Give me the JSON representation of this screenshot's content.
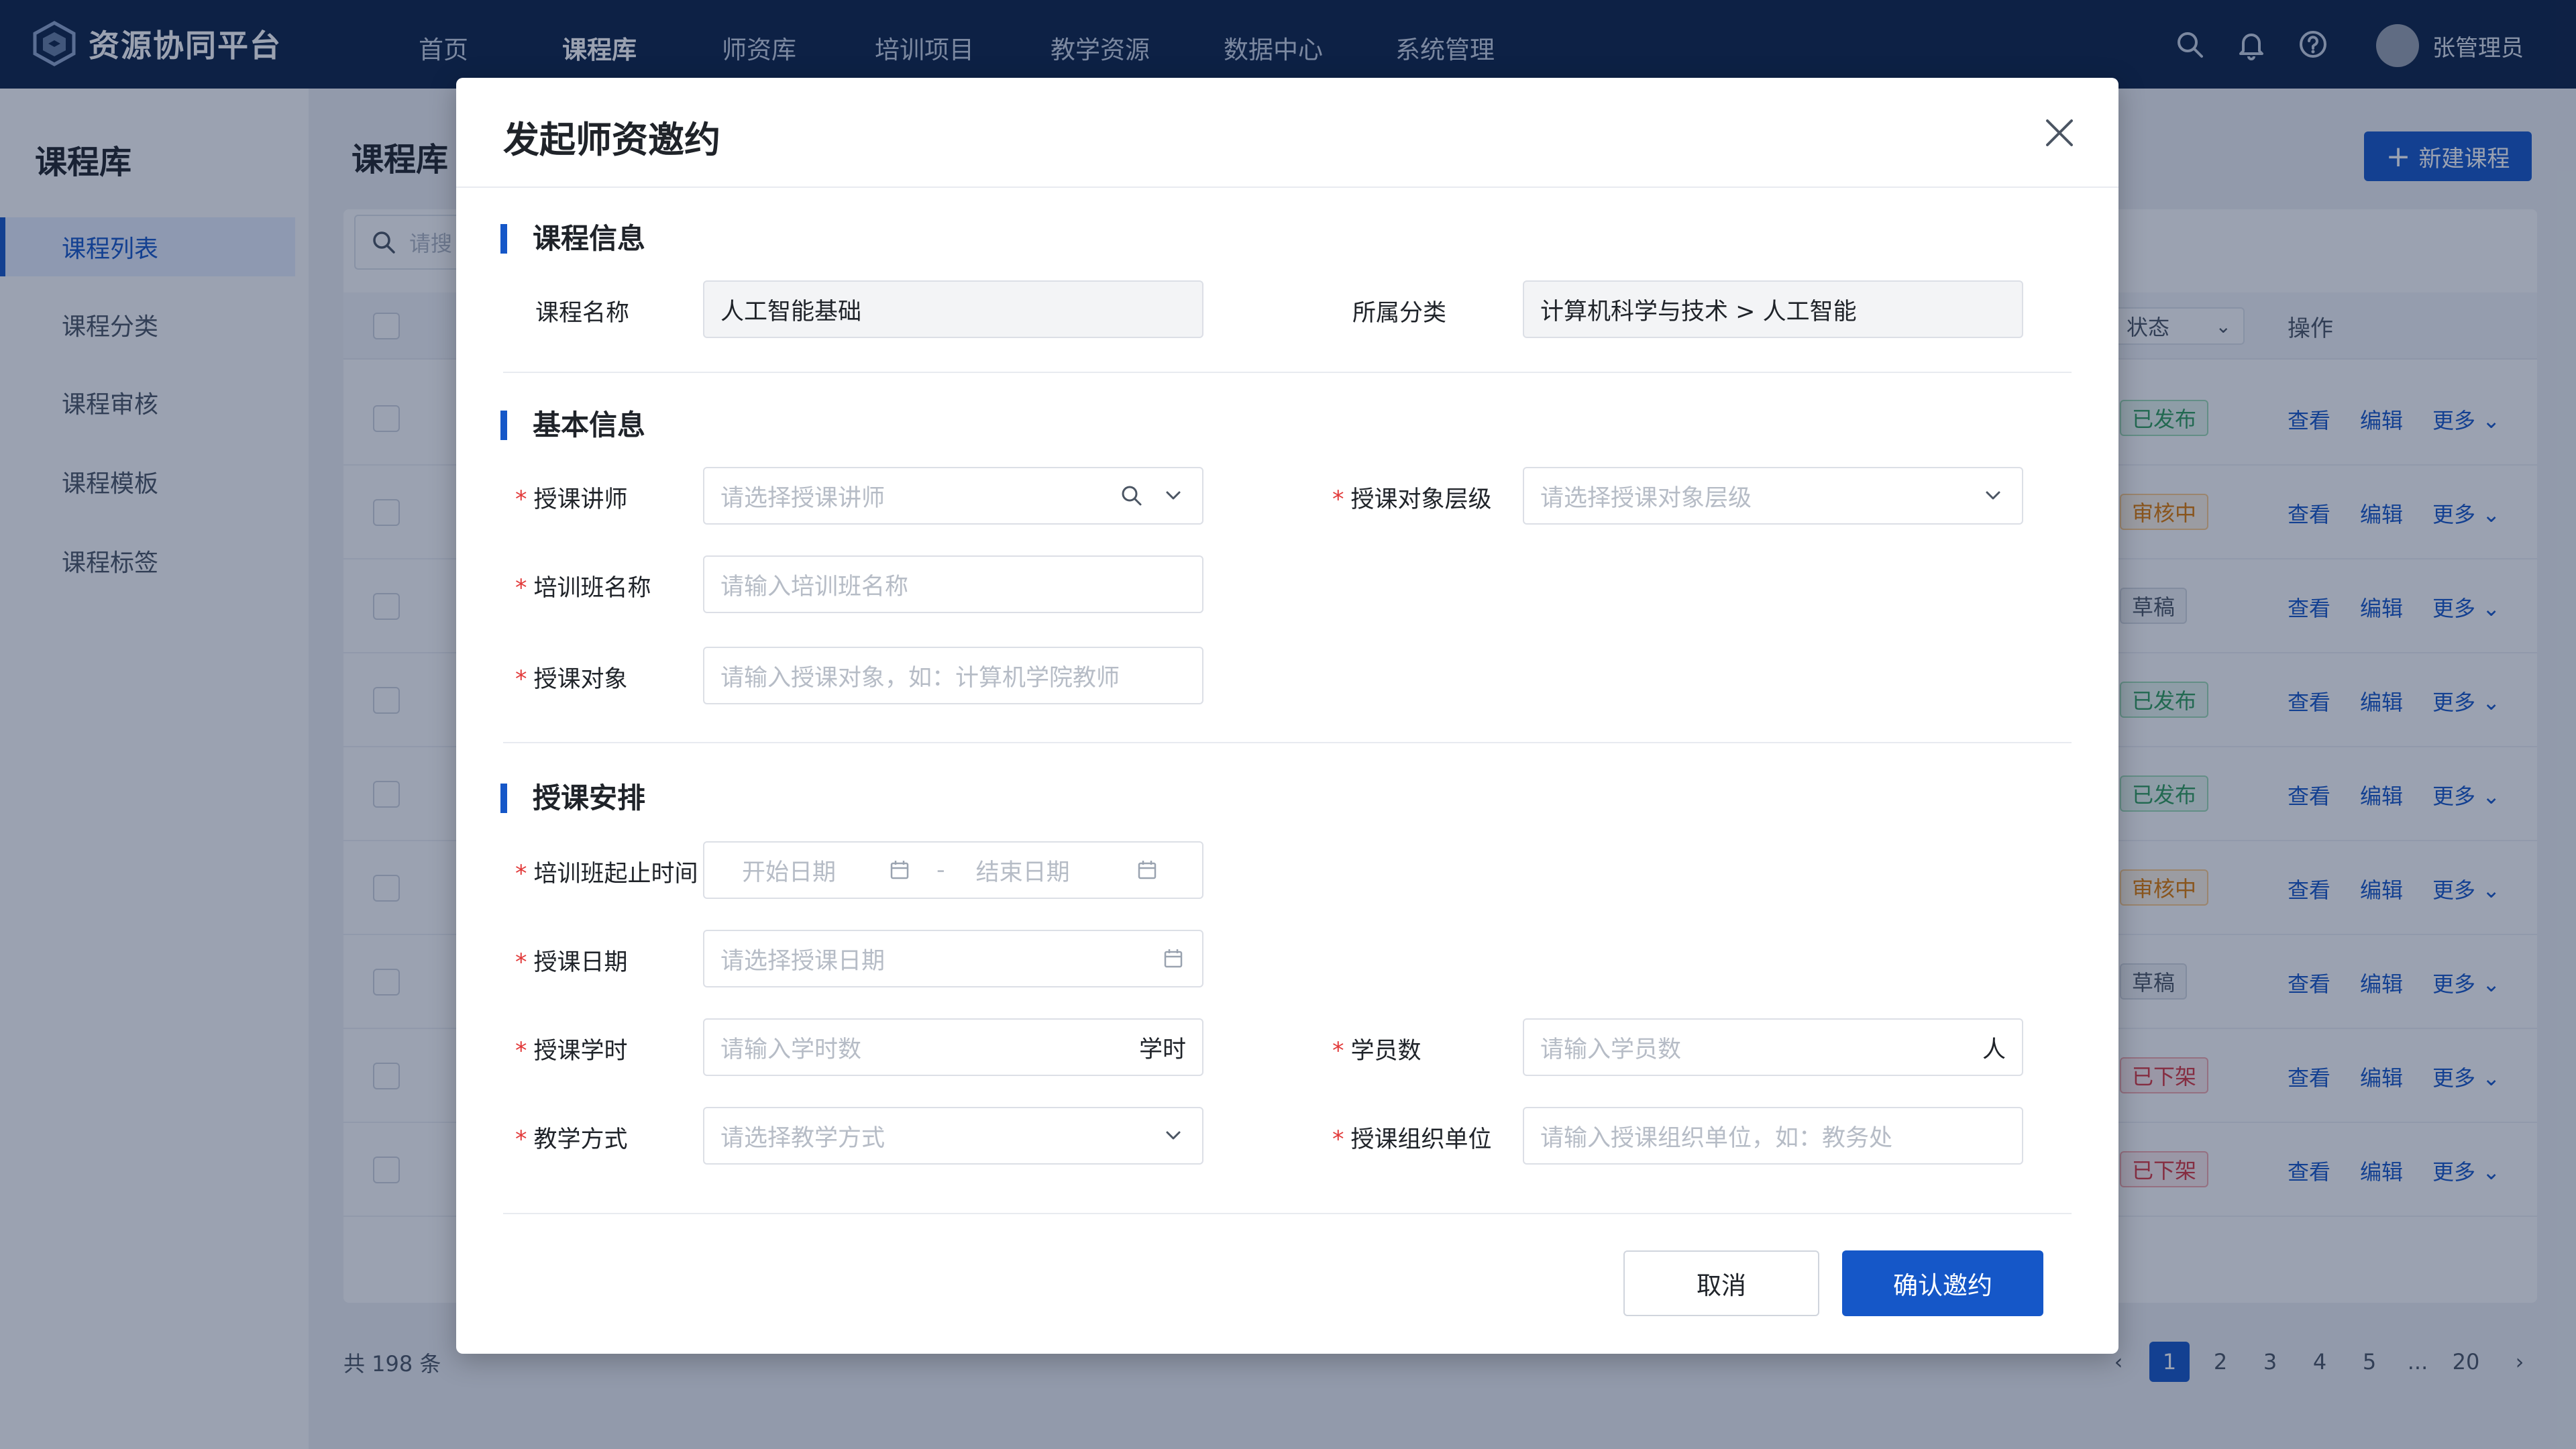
{
  "app": {
    "brand": "资源协同平台"
  },
  "nav": {
    "items": [
      "首页",
      "课程库",
      "师资库",
      "培训项目",
      "教学资源",
      "数据中心",
      "系统管理"
    ],
    "active_index": 1
  },
  "user": {
    "name": "张管理员"
  },
  "sidebar": {
    "title": "课程库",
    "items": [
      "课程列表",
      "课程分类",
      "课程审核",
      "课程模板",
      "课程标签"
    ],
    "active_index": 0
  },
  "main": {
    "title": "课程库",
    "new_button": "新建课程",
    "search_placeholder": "请搜",
    "status_header": "状态",
    "op_header": "操作",
    "rows": [
      {
        "status": "已发布",
        "type": "pub"
      },
      {
        "status": "审核中",
        "type": "rev"
      },
      {
        "status": "草稿",
        "type": "draft"
      },
      {
        "status": "已发布",
        "type": "pub"
      },
      {
        "status": "已发布",
        "type": "pub"
      },
      {
        "status": "审核中",
        "type": "rev"
      },
      {
        "status": "草稿",
        "type": "draft"
      },
      {
        "status": "已下架",
        "type": "off"
      },
      {
        "status": "已下架",
        "type": "off"
      }
    ],
    "row_actions": [
      "查看",
      "编辑",
      "更多"
    ],
    "total": "共 198 条",
    "pages": [
      "1",
      "2",
      "3",
      "4",
      "5",
      "...",
      "20"
    ],
    "current_page": "1"
  },
  "modal": {
    "title": "发起师资邀约",
    "sections": {
      "course_info": "课程信息",
      "basic_info": "基本信息",
      "schedule": "授课安排"
    },
    "course_info": {
      "name_label": "课程名称",
      "name_value": "人工智能基础",
      "category_label": "所属分类",
      "category_value": "计算机科学与技术 > 人工智能"
    },
    "basic_info": {
      "lecturer_label": "授课讲师",
      "lecturer_placeholder": "请选择授课讲师",
      "audience_level_label": "授课对象层级",
      "audience_level_placeholder": "请选择授课对象层级",
      "class_name_label": "培训班名称",
      "class_name_placeholder": "请输入培训班名称",
      "audience_label": "授课对象",
      "audience_placeholder": "请输入授课对象，如：计算机学院教师"
    },
    "schedule": {
      "period_label": "培训班起止时间",
      "start_placeholder": "开始日期",
      "range_separator": "-",
      "end_placeholder": "结束日期",
      "date_label": "授课日期",
      "date_placeholder": "请选择授课日期",
      "hours_label": "授课学时",
      "hours_placeholder": "请输入学时数",
      "hours_suffix": "学时",
      "students_label": "学员数",
      "students_placeholder": "请输入学员数",
      "students_suffix": "人",
      "method_label": "教学方式",
      "method_placeholder": "请选择教学方式",
      "org_label": "授课组织单位",
      "org_placeholder": "请输入授课组织单位，如：教务处"
    },
    "required_mark": "*",
    "cancel": "取消",
    "confirm": "确认邀约"
  },
  "colors": {
    "primary": "#1557c8",
    "nav_bg": "#0c2145",
    "required": "#e23b3b"
  }
}
